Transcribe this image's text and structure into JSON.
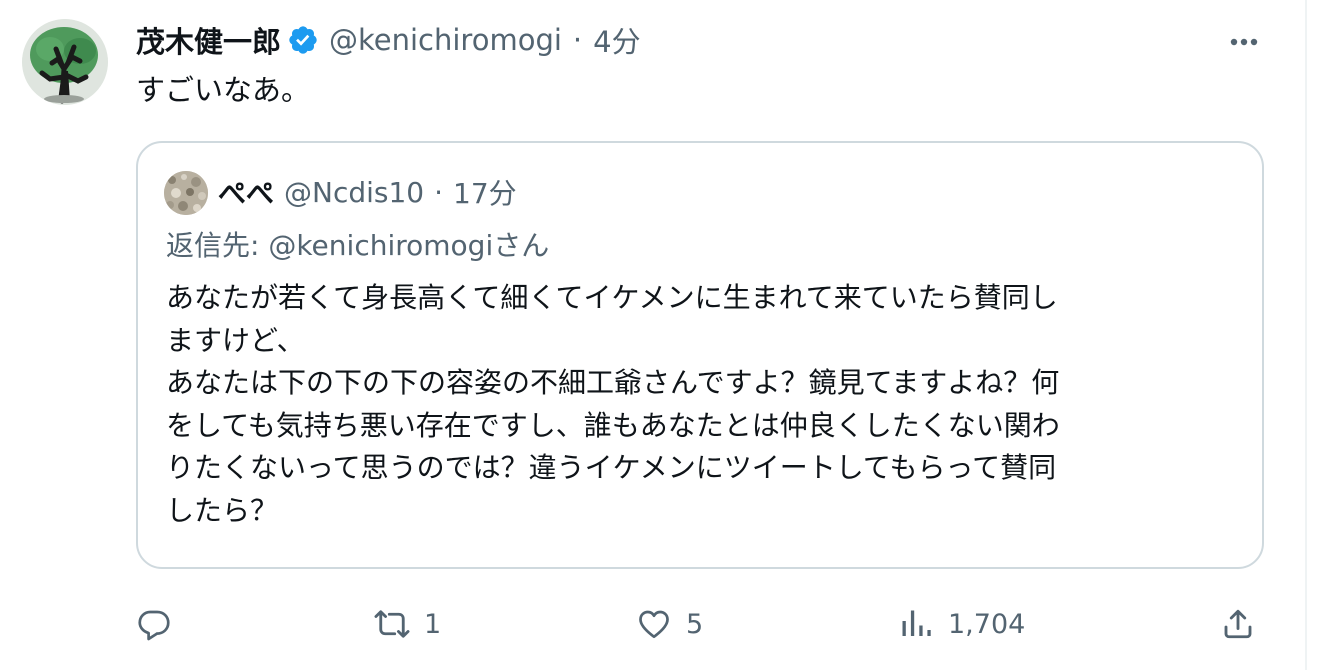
{
  "tweet": {
    "author_name": "茂木健一郎",
    "author_handle": "@kenichiromogi",
    "separator": "·",
    "time": "4分",
    "text": "すごいなあ。"
  },
  "quote": {
    "author_name": "ぺぺ",
    "author_handle": "@Ncdis10",
    "separator": "·",
    "time": "17分",
    "reply_prefix": "返信先: ",
    "reply_target": "@kenichiromogi",
    "reply_suffix": "さん",
    "lines": [
      "あなたが若くて身長高くて細くてイケメンに生まれて来ていたら賛同し",
      "ますけど、",
      "あなたは下の下の下の容姿の不細工爺さんですよ？鏡見てますよね？何",
      "をしても気持ち悪い存在ですし、誰もあなたとは仲良くしたくない関わ",
      "りたくないって思うのでは？違うイケメンにツイートしてもらって賛同",
      "したら？"
    ]
  },
  "actions": {
    "reply_count": "",
    "retweet_count": "1",
    "like_count": "5",
    "view_count": "1,704"
  },
  "colors": {
    "verified_blue": "#1d9bf0",
    "secondary_text": "#536471",
    "border": "#cfd9de"
  }
}
